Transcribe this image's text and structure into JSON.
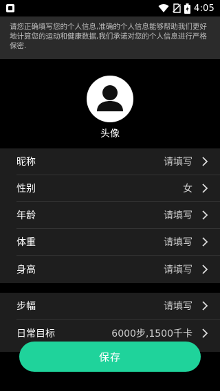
{
  "status_bar": {
    "time": "4:05",
    "icons": [
      "app-notification-icon",
      "wifi-icon",
      "no-sim-icon",
      "battery-icon"
    ]
  },
  "info_banner": {
    "text": "请您正确填写您的个人信息,准确的个人信息能够帮助我们更好地计算您的运动和健康数据,我们承诺对您的个人信息进行严格保密."
  },
  "avatar": {
    "label": "头像",
    "icon": "user-silhouette-icon"
  },
  "profile": {
    "rows": [
      {
        "label": "昵称",
        "value": "请填写"
      },
      {
        "label": "性别",
        "value": "女"
      },
      {
        "label": "年龄",
        "value": "请填写"
      },
      {
        "label": "体重",
        "value": "请填写"
      },
      {
        "label": "身高",
        "value": "请填写"
      }
    ]
  },
  "activity": {
    "rows": [
      {
        "label": "步幅",
        "value": "请填写"
      },
      {
        "label": "日常目标",
        "value": "6000步,1500千卡"
      }
    ]
  },
  "save_button": {
    "label": "保存"
  },
  "colors": {
    "accent": "#1fd39b",
    "background": "#000000",
    "banner": "#2b2b2b",
    "list_background": "#1e1e1e"
  }
}
